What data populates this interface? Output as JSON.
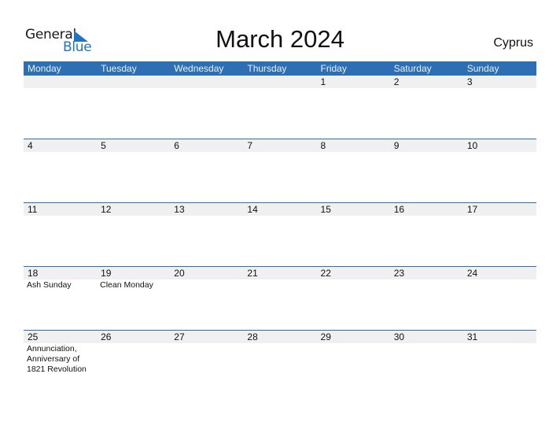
{
  "logo": {
    "part1": "General",
    "part2": "Blue",
    "accent_color": "#1e74c6"
  },
  "title": "March 2024",
  "country": "Cyprus",
  "header_color": "#2e6fb3",
  "weekdays": [
    "Monday",
    "Tuesday",
    "Wednesday",
    "Thursday",
    "Friday",
    "Saturday",
    "Sunday"
  ],
  "weeks": [
    {
      "days": [
        {
          "n": "",
          "e": ""
        },
        {
          "n": "",
          "e": ""
        },
        {
          "n": "",
          "e": ""
        },
        {
          "n": "",
          "e": ""
        },
        {
          "n": "1",
          "e": ""
        },
        {
          "n": "2",
          "e": ""
        },
        {
          "n": "3",
          "e": ""
        }
      ]
    },
    {
      "days": [
        {
          "n": "4",
          "e": ""
        },
        {
          "n": "5",
          "e": ""
        },
        {
          "n": "6",
          "e": ""
        },
        {
          "n": "7",
          "e": ""
        },
        {
          "n": "8",
          "e": ""
        },
        {
          "n": "9",
          "e": ""
        },
        {
          "n": "10",
          "e": ""
        }
      ]
    },
    {
      "days": [
        {
          "n": "11",
          "e": ""
        },
        {
          "n": "12",
          "e": ""
        },
        {
          "n": "13",
          "e": ""
        },
        {
          "n": "14",
          "e": ""
        },
        {
          "n": "15",
          "e": ""
        },
        {
          "n": "16",
          "e": ""
        },
        {
          "n": "17",
          "e": ""
        }
      ]
    },
    {
      "days": [
        {
          "n": "18",
          "e": "Ash Sunday"
        },
        {
          "n": "19",
          "e": "Clean Monday"
        },
        {
          "n": "20",
          "e": ""
        },
        {
          "n": "21",
          "e": ""
        },
        {
          "n": "22",
          "e": ""
        },
        {
          "n": "23",
          "e": ""
        },
        {
          "n": "24",
          "e": ""
        }
      ]
    },
    {
      "days": [
        {
          "n": "25",
          "e": "Annunciation, Anniversary of 1821 Revolution"
        },
        {
          "n": "26",
          "e": ""
        },
        {
          "n": "27",
          "e": ""
        },
        {
          "n": "28",
          "e": ""
        },
        {
          "n": "29",
          "e": ""
        },
        {
          "n": "30",
          "e": ""
        },
        {
          "n": "31",
          "e": ""
        }
      ]
    }
  ]
}
